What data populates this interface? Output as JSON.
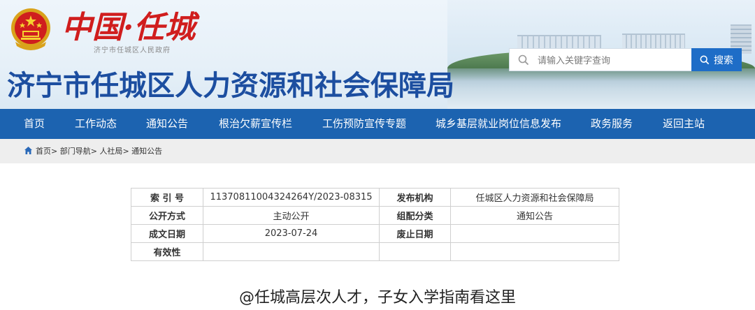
{
  "header": {
    "logo_text": "中国·任城",
    "gov_name": "济宁市任城区人民政府",
    "site_title": "济宁市任城区人力资源和社会保障局"
  },
  "search": {
    "placeholder": "请输入关键字查询",
    "button_label": "搜索"
  },
  "nav": {
    "items": [
      {
        "label": "首页"
      },
      {
        "label": "工作动态"
      },
      {
        "label": "通知公告"
      },
      {
        "label": "根治欠薪宣传栏"
      },
      {
        "label": "工伤预防宣传专题"
      },
      {
        "label": "城乡基层就业岗位信息发布"
      },
      {
        "label": "政务服务"
      },
      {
        "label": "返回主站"
      }
    ]
  },
  "breadcrumb": {
    "items": [
      "首页",
      "部门导航",
      "人社局",
      "通知公告"
    ],
    "separator": ">"
  },
  "info": {
    "row1": {
      "label_a": "索 引 号",
      "value_a": "11370811004324264Y/2023-08315",
      "label_b": "发布机构",
      "value_b": "任城区人力资源和社会保障局"
    },
    "row2": {
      "label_a": "公开方式",
      "value_a": "主动公开",
      "label_b": "组配分类",
      "value_b": "通知公告"
    },
    "row3": {
      "label_a": "成文日期",
      "value_a": "2023-07-24",
      "label_b": "废止日期",
      "value_b": ""
    },
    "row4": {
      "label_a": "有效性",
      "value_a": "",
      "label_b": "",
      "value_b": ""
    }
  },
  "article": {
    "title": "@任城高层次人才，子女入学指南看这里"
  },
  "colors": {
    "primary": "#1c63b0",
    "title_blue": "#1c4ea0",
    "search_button": "#1e6dc7",
    "logo_red": "#d01d1d",
    "breadcrumb_bg": "#eeeeee"
  },
  "icons": {
    "search": "magnifier-icon",
    "home": "home-icon",
    "emblem": "national-emblem-icon"
  }
}
